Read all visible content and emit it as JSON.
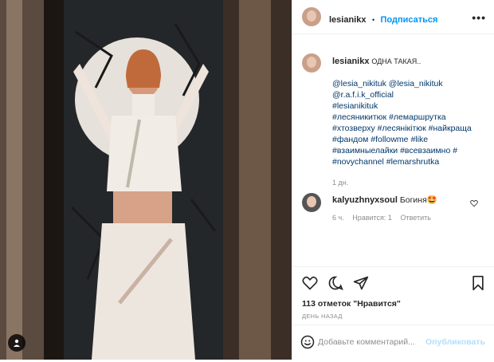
{
  "post": {
    "username": "lesianikx",
    "follow_label": "Подписаться",
    "separator": "•",
    "caption_text": "ОДНА ТАКАЯ..",
    "mentions": [
      "@lesia_nikituk",
      "@lesia_nikituk",
      "@r.a.f.i.k_official"
    ],
    "hashtags": [
      "#lesianikituk",
      "#лесяникитюк",
      "#лемаршрутка",
      "#хтозверху",
      "#лесянікітюк",
      "#найкраща",
      "#фандом",
      "#followme",
      "#like",
      "#взаимныелайки",
      "#всевзаимно",
      "#",
      "#novychannel",
      "#lemarshrutka"
    ],
    "caption_time": "1 дн."
  },
  "comment": {
    "username": "kalyuzhnyxsoul",
    "text": "Богиня🤩",
    "time": "6 ч.",
    "likes": "Нравится: 1",
    "reply": "Ответить"
  },
  "stats": {
    "likes": "113 отметок \"Нравится\"",
    "date": "ДЕНЬ НАЗАД"
  },
  "comment_box": {
    "placeholder": "Добавьте комментарий...",
    "publish": "Опубликовать"
  },
  "icons": [
    "more-icon",
    "heart-icon",
    "comment-icon",
    "share-icon",
    "bookmark-icon",
    "emoji-icon",
    "user-tag-icon"
  ],
  "colors": {
    "link": "#00376b",
    "follow": "#0095f6",
    "publish_disabled": "#b2dffc",
    "muted": "#8e8e8e"
  }
}
